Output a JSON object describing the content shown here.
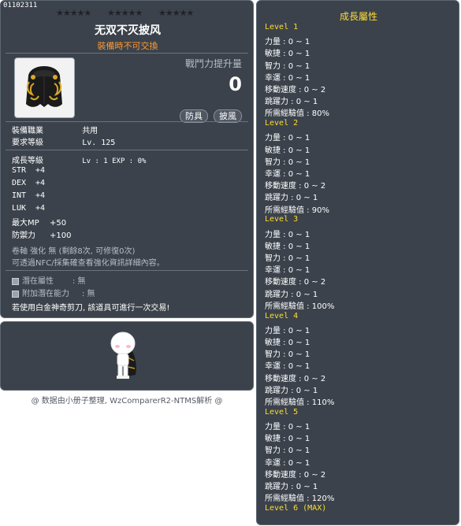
{
  "item": {
    "id": "01102311",
    "stars": [
      "★★★★★",
      "★★★★★",
      "★★★★★"
    ],
    "name": "无双不灭披风",
    "restriction": "裝備時不可交換",
    "power_label": "戰鬥力提升量",
    "power_value": "0",
    "tags": [
      "防具",
      "披風"
    ],
    "job_label": "裝備職業",
    "job_value": "共用",
    "req_level_label": "要求等級",
    "req_level_value": "Lv. 125",
    "growth_label": "成長等級",
    "growth_value": "Lv : 1  EXP : 0%",
    "stats": [
      {
        "k": "STR",
        "v": "+4"
      },
      {
        "k": "DEX",
        "v": "+4"
      },
      {
        "k": "INT",
        "v": "+4"
      },
      {
        "k": "LUK",
        "v": "+4"
      },
      {
        "k": "最大MP",
        "v": "+50"
      },
      {
        "k": "防禦力",
        "v": "+100"
      }
    ],
    "scroll_line": "卷軸 強化 無 (剩餘8次, 可修復0次)",
    "nfc_line": "可透過NFC/採集確查看強化資訊詳細內容。",
    "potential_label": "潛在屬性",
    "potential_value": ": 無",
    "addl_potential_label": "附加潛在能力",
    "addl_potential_value": ": 無",
    "trade_note": "若使用白金神奇剪刀, 該道具可進行一次交易!"
  },
  "footer": "@ 数据由小册子整理, WzComparerR2-NTMS解析 @",
  "growth": {
    "title": "成長屬性",
    "levels": [
      {
        "title": "Level 1",
        "lines": [
          "力量 : 0 ~ 1",
          "敏捷 : 0 ~ 1",
          "智力 : 0 ~ 1",
          "幸運 : 0 ~ 1",
          "移動速度 : 0 ~ 2",
          "跳躍力 : 0 ~ 1",
          "所需經驗值 : 80%"
        ]
      },
      {
        "title": "Level 2",
        "lines": [
          "力量 : 0 ~ 1",
          "敏捷 : 0 ~ 1",
          "智力 : 0 ~ 1",
          "幸運 : 0 ~ 1",
          "移動速度 : 0 ~ 2",
          "跳躍力 : 0 ~ 1",
          "所需經驗值 : 90%"
        ]
      },
      {
        "title": "Level 3",
        "lines": [
          "力量 : 0 ~ 1",
          "敏捷 : 0 ~ 1",
          "智力 : 0 ~ 1",
          "幸運 : 0 ~ 1",
          "移動速度 : 0 ~ 2",
          "跳躍力 : 0 ~ 1",
          "所需經驗值 : 100%"
        ]
      },
      {
        "title": "Level 4",
        "lines": [
          "力量 : 0 ~ 1",
          "敏捷 : 0 ~ 1",
          "智力 : 0 ~ 1",
          "幸運 : 0 ~ 1",
          "移動速度 : 0 ~ 2",
          "跳躍力 : 0 ~ 1",
          "所需經驗值 : 110%"
        ]
      },
      {
        "title": "Level 5",
        "lines": [
          "力量 : 0 ~ 1",
          "敏捷 : 0 ~ 1",
          "智力 : 0 ~ 1",
          "幸運 : 0 ~ 1",
          "移動速度 : 0 ~ 2",
          "跳躍力 : 0 ~ 1",
          "所需經驗值 : 120%"
        ]
      },
      {
        "title": "Level 6 (MAX)",
        "lines": []
      }
    ]
  }
}
